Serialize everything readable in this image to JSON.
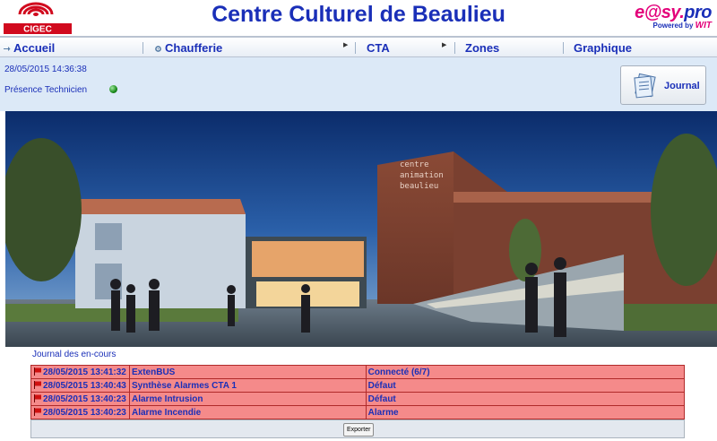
{
  "header": {
    "title": "Centre Culturel de Beaulieu",
    "logo_text": "CIGEC",
    "brand_left": "e@sy.",
    "brand_right": "pro",
    "brand_sub": "Powered by",
    "brand_sub2": "WIT"
  },
  "nav": {
    "items": [
      {
        "label": "Accueil",
        "icon": "arrow-icon"
      },
      {
        "label": "Chaufferie",
        "icon": "gear-icon"
      },
      {
        "label": "CTA"
      },
      {
        "label": "Zones"
      },
      {
        "label": "Graphique"
      }
    ]
  },
  "status": {
    "datetime": "28/05/2015 14:36:38",
    "presence_label": "Présence Technicien",
    "presence_color": "#1a8a1a"
  },
  "journal_button": {
    "label": "Journal"
  },
  "photo": {
    "sign_line1": "centre",
    "sign_line2": "animation",
    "sign_line3": "beaulieu"
  },
  "journal": {
    "title": "Journal des en-cours",
    "rows": [
      {
        "date": "28/05/2015 13:41:32",
        "name": "ExtenBUS",
        "state": "Connecté (6/7)"
      },
      {
        "date": "28/05/2015 13:40:43",
        "name": "Synthèse Alarmes CTA 1",
        "state": "Défaut"
      },
      {
        "date": "28/05/2015 13:40:23",
        "name": "Alarme Intrusion",
        "state": "Défaut"
      },
      {
        "date": "28/05/2015 13:40:23",
        "name": "Alarme Incendie",
        "state": "Alarme"
      }
    ],
    "export_label": "Exporter"
  },
  "colors": {
    "accent": "#1a2fb8",
    "alarm_row": "#f58a8a",
    "info_bg": "#dce9f7"
  }
}
